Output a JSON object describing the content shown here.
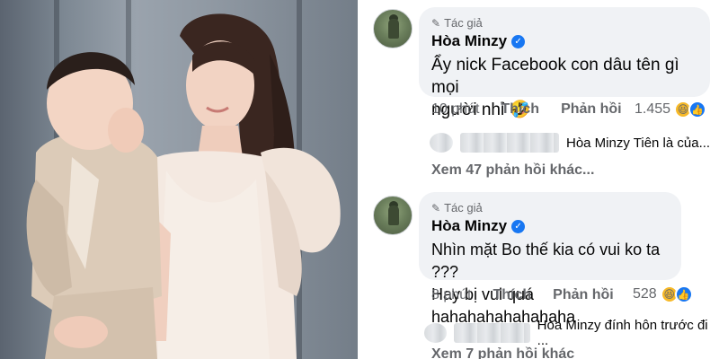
{
  "photo": {
    "description_icon": "photo-image"
  },
  "comments": [
    {
      "author_tag": "Tác giả",
      "author_name": "Hòa Minzy",
      "verified_icon": "verified-check-icon",
      "lines": [
        "Ẩy nick Facebook con dâu tên gì mọi",
        "người nhỉ 🤣"
      ],
      "time": "10 phút",
      "like_label": "Thích",
      "reply_label": "Phản hồi",
      "reaction_count": "1.455",
      "reply_preview": "Hòa Minzy Tiên là của...",
      "more_replies": "Xem 47 phản hồi khác..."
    },
    {
      "author_tag": "Tác giả",
      "author_name": "Hòa Minzy",
      "verified_icon": "verified-check-icon",
      "lines": [
        "Nhìn mặt Bo thế kia có vui ko ta ???",
        "Hay bị vui quá hahahahahahahaha"
      ],
      "time": "8 phút",
      "like_label": "Thích",
      "reply_label": "Phản hồi",
      "reaction_count": "528",
      "reply_preview": "Hòa Minzy đính hôn trước đi ...",
      "more_replies": "Xem 7 phản hồi khác"
    }
  ],
  "colors": {
    "bubble_bg": "#f0f2f5",
    "verified": "#1877f2",
    "meta_text": "#65676b"
  }
}
